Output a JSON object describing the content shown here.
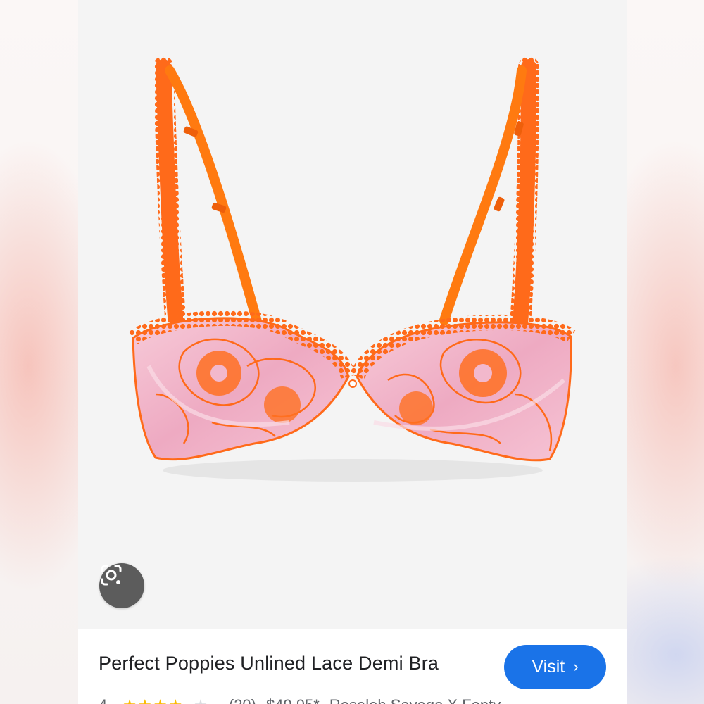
{
  "product": {
    "title": "Perfect Poppies Unlined Lace Demi Bra",
    "rating": "4",
    "stars_filled": 4,
    "stars_total": 5,
    "review_count": "(20)",
    "price": "$49.95*",
    "seller": "Rosaleh Savage X Fenty"
  },
  "actions": {
    "visit_label": "Visit",
    "visit_chevron": "›"
  },
  "icons": {
    "lens": "google-lens-icon",
    "chevron": "chevron-right-icon",
    "star": "star-icon"
  },
  "colors": {
    "accent": "#1a73e8",
    "lace_orange": "#ff6a1a",
    "satin_pink": "#f2b8cc",
    "star": "#fbbc04"
  }
}
